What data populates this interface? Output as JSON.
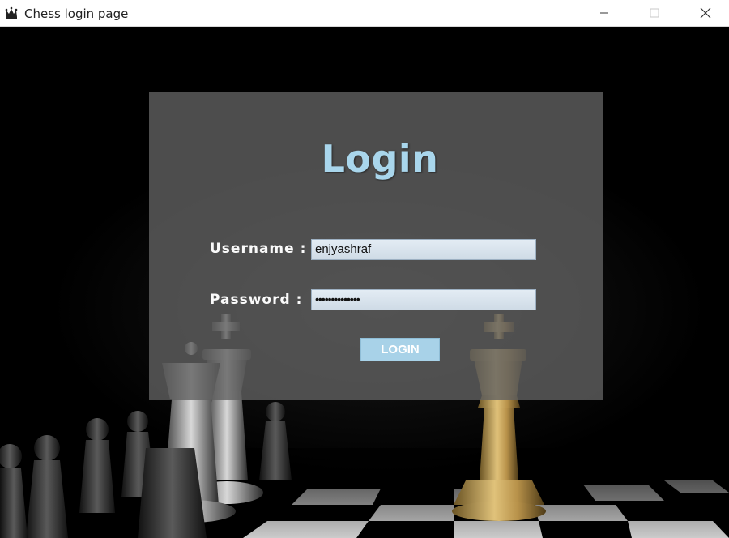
{
  "window": {
    "title": "Chess login page",
    "controls": [
      "minimize",
      "maximize",
      "close"
    ]
  },
  "login": {
    "heading": "Login",
    "username_label": "Username :",
    "username_value": "enjyashraf",
    "password_label": "Password :",
    "password_masked": "••••••••••••••",
    "button_label": "LOGIN"
  },
  "colors": {
    "heading": "#a9d6ec",
    "button": "#a8d2e8",
    "panel": "#606060",
    "field": "#d8e3ed"
  },
  "icons": {
    "app": "chess-crown-icon",
    "minimize": "minimize-icon",
    "maximize": "maximize-icon",
    "close": "close-icon"
  }
}
